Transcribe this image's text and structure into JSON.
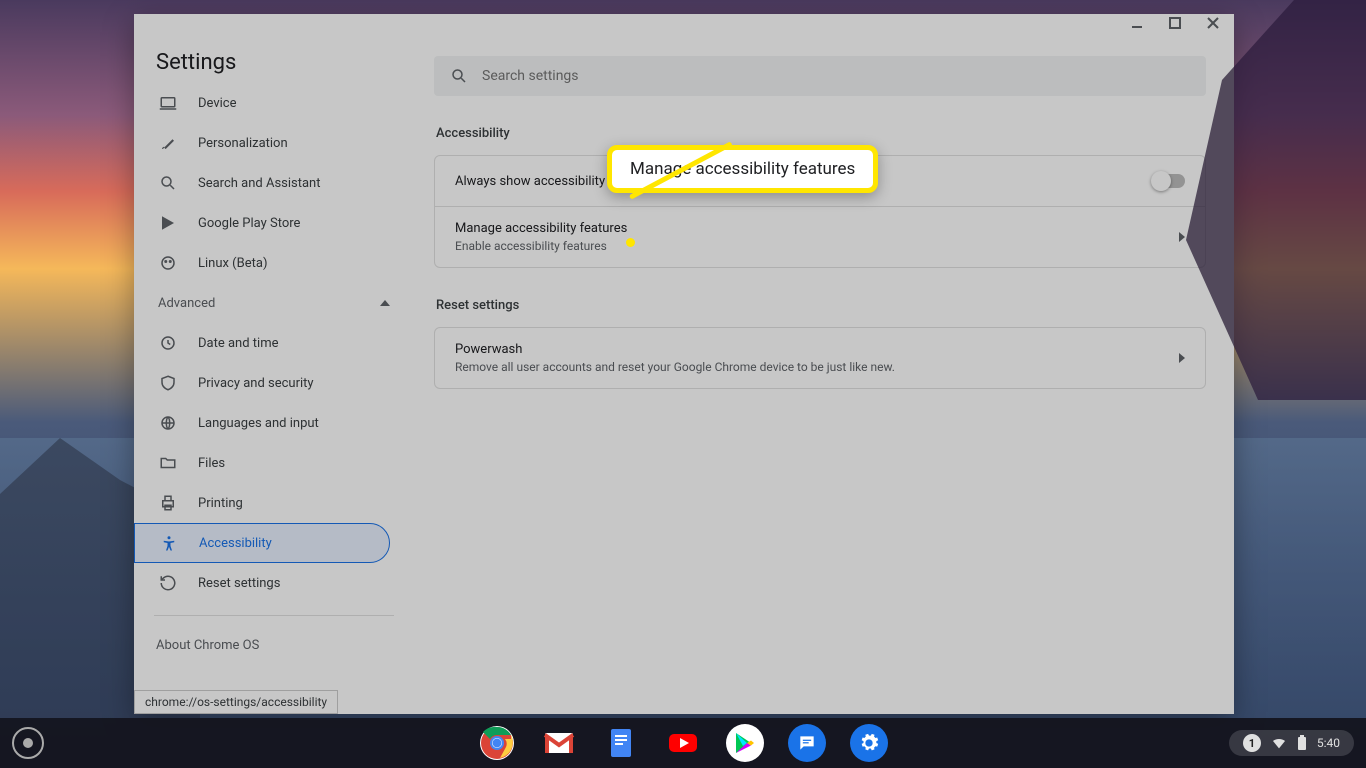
{
  "app_title": "Settings",
  "search": {
    "placeholder": "Search settings"
  },
  "sidebar": {
    "main_items": [
      {
        "icon": "laptop",
        "label": "Device"
      },
      {
        "icon": "brush",
        "label": "Personalization"
      },
      {
        "icon": "search",
        "label": "Search and Assistant"
      },
      {
        "icon": "play",
        "label": "Google Play Store"
      },
      {
        "icon": "linux",
        "label": "Linux (Beta)"
      }
    ],
    "advanced_label": "Advanced",
    "advanced_items": [
      {
        "icon": "clock",
        "label": "Date and time"
      },
      {
        "icon": "shield",
        "label": "Privacy and security"
      },
      {
        "icon": "globe",
        "label": "Languages and input"
      },
      {
        "icon": "folder",
        "label": "Files"
      },
      {
        "icon": "printer",
        "label": "Printing"
      },
      {
        "icon": "a11y",
        "label": "Accessibility",
        "active": true
      },
      {
        "icon": "restore",
        "label": "Reset settings"
      }
    ],
    "about": "About Chrome OS"
  },
  "sections": {
    "a11y": {
      "title": "Accessibility",
      "row1": "Always show accessibility options in the system menu",
      "row2_title": "Manage accessibility features",
      "row2_sub": "Enable accessibility features"
    },
    "reset": {
      "title": "Reset settings",
      "row_title": "Powerwash",
      "row_sub": "Remove all user accounts and reset your Google Chrome device to be just like new."
    }
  },
  "callout": "Manage accessibility features",
  "urlbar": "chrome://os-settings/accessibility",
  "tray": {
    "notif": "1",
    "time": "5:40"
  }
}
